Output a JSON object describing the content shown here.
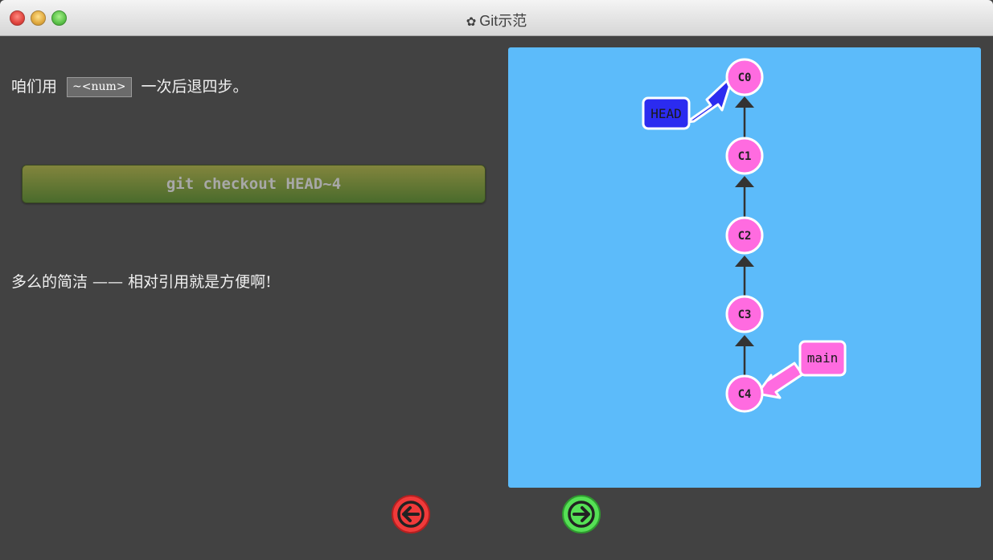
{
  "window": {
    "title": "Git示范",
    "title_icon": "gear-icon"
  },
  "content": {
    "line1_before": "咱们用",
    "line1_code": "~<num>",
    "line1_after": "一次后退四步。",
    "command": "git checkout HEAD~4",
    "line2": "多么的简洁 —— 相对引用就是方便啊!"
  },
  "graph": {
    "commits": [
      "C0",
      "C1",
      "C2",
      "C3",
      "C4"
    ],
    "branches": [
      {
        "label": "HEAD",
        "target": "C0",
        "color": "#2b2bf0"
      },
      {
        "label": "main",
        "target": "C4",
        "color": "#ff6be0"
      }
    ],
    "background": "#5cbbfa",
    "commit_color": "#ff6be0"
  },
  "nav": {
    "back_icon": "left-arrow-icon",
    "forward_icon": "right-arrow-icon",
    "back_color": "#f03a3a",
    "forward_color": "#55e055"
  }
}
